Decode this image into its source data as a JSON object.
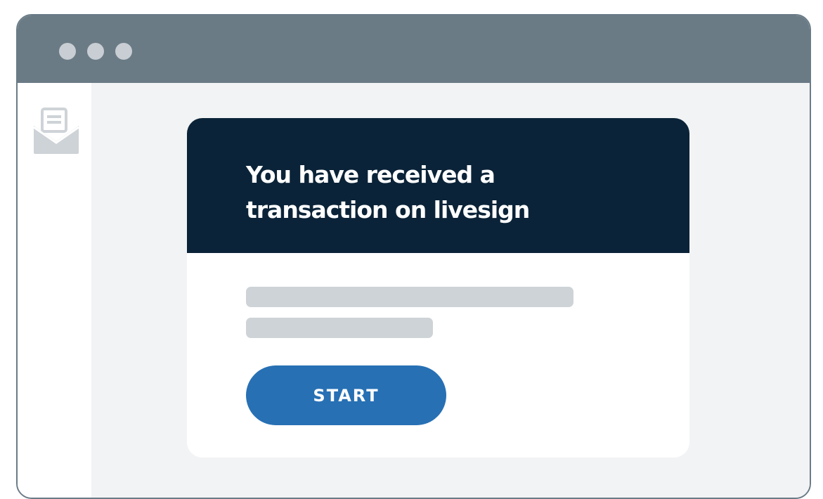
{
  "window": {
    "title_bar": {
      "controls": [
        "window-dot-1",
        "window-dot-2",
        "window-dot-3"
      ]
    }
  },
  "sidebar": {
    "icon": "open-envelope-icon"
  },
  "card": {
    "title": "You have received a transaction on livesign",
    "button_label": "START"
  },
  "colors": {
    "titlebar": "#6a7b86",
    "card_header": "#0b2338",
    "button": "#2770b4",
    "content_bg": "#f2f3f5",
    "placeholder_bar": "#ced3d7"
  }
}
